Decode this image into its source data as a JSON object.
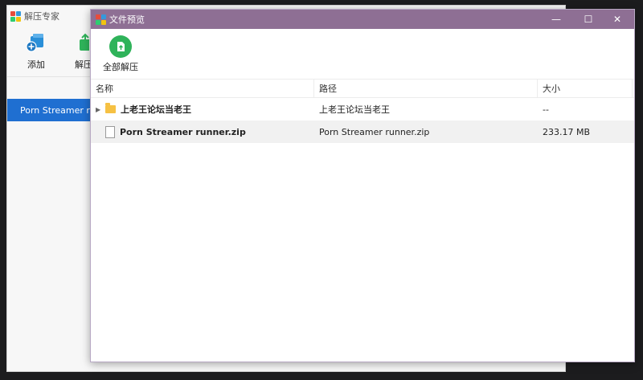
{
  "background_window": {
    "title": "解压专家",
    "toolbar": {
      "add_label": "添加",
      "extract_label_partial": "解压"
    },
    "selected_item": "Porn Streamer runner.zip"
  },
  "dialog": {
    "title": "文件预览",
    "controls": {
      "minimize": "—",
      "maximize": "☐",
      "close": "✕"
    },
    "extract_all_label": "全部解压",
    "columns": {
      "name": "名称",
      "path": "路径",
      "size": "大小"
    },
    "rows": [
      {
        "name": "上老王论坛当老王",
        "path": "上老王论坛当老王",
        "size": "--",
        "type": "folder"
      },
      {
        "name": "Porn Streamer runner.zip",
        "path": "Porn Streamer runner.zip",
        "size": "233.17 MB",
        "type": "file"
      }
    ]
  },
  "colors": {
    "dialog_title_bar": "#8e6f94",
    "selection": "#1f6fd1",
    "extract_button": "#2fb35a",
    "folder": "#f6c143"
  },
  "icons": {
    "app": "app-grid-icon",
    "add": "add-archive-icon",
    "extract": "extract-icon",
    "extract_all": "extract-all-icon"
  }
}
